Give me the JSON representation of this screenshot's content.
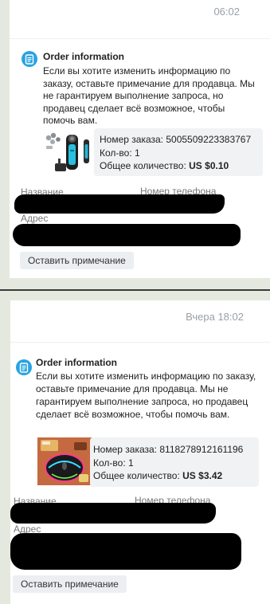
{
  "messages": [
    {
      "time": "06:02",
      "card": {
        "title": "Order information",
        "text": "Если вы хотите изменить информацию по заказу, оставьте примечание для продавца. Мы не гарантируем выполнение запроса, но продавец сделает всё возможное, чтобы помочь вам.",
        "product_image": "electric-shaver-set",
        "order_number_label": "Номер заказа:",
        "order_number": "5005509223383767",
        "qty_label": "Кол-во:",
        "qty": "1",
        "total_label": "Общее количество:",
        "total": "US $0.10"
      },
      "name_label": "Название",
      "phone_label": "Номер телефона",
      "address_label": "Адрес",
      "note_button": "Оставить примечание"
    },
    {
      "time": "Вчера 18:02",
      "card": {
        "title": "Order information",
        "text": "Если вы хотите изменить информацию по заказу, оставьте примечание для продавца. Мы не гарантируем выполнение запроса, но продавец сделает всё возможное, чтобы помочь вам.",
        "product_image": "rgb-gaming-mouse",
        "order_number_label": "Номер заказа:",
        "order_number": "8118278912161196",
        "qty_label": "Кол-во:",
        "qty": "1",
        "total_label": "Общее количество:",
        "total": "US $3.42"
      },
      "name_label": "Название",
      "phone_label": "Номер телефона",
      "address_label": "Адрес",
      "note_button": "Оставить примечание"
    }
  ],
  "colors": {
    "info_icon": "#2aa3e0",
    "order_box_bg": "#f1f2f3",
    "label_gray": "#777777",
    "redaction": "#000000",
    "app_bg": "#e4e8de"
  }
}
